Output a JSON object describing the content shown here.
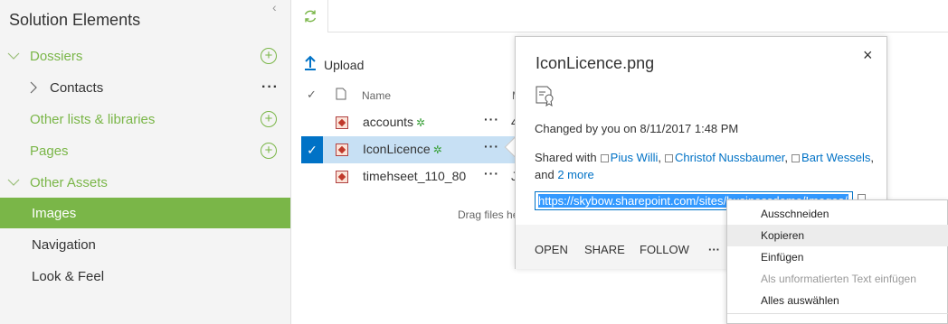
{
  "sidebar": {
    "title": "Solution Elements",
    "collapse_glyph": "‹",
    "items": [
      {
        "label": "Dossiers",
        "kind": "section",
        "expanded": true
      },
      {
        "label": "Contacts",
        "kind": "child"
      },
      {
        "label": "Other lists & libraries",
        "kind": "section"
      },
      {
        "label": "Pages",
        "kind": "section"
      },
      {
        "label": "Other Assets",
        "kind": "section",
        "expanded": true
      },
      {
        "label": "Images",
        "kind": "child",
        "active": true
      },
      {
        "label": "Navigation",
        "kind": "child"
      },
      {
        "label": "Look & Feel",
        "kind": "child"
      }
    ]
  },
  "library": {
    "upload_label": "Upload",
    "header_name": "Name",
    "header_modified_initial": "M",
    "rows": [
      {
        "name": "accounts",
        "trail": "4"
      },
      {
        "name": "IconLicence",
        "trail": ""
      },
      {
        "name": "timehseet_110_80",
        "trail": "J"
      }
    ],
    "drag_text": "Drag files he"
  },
  "callout": {
    "title": "IconLicence.png",
    "close": "×",
    "changed": "Changed by you on 8/11/2017 1:48 PM",
    "shared_prefix": "Shared with",
    "people": [
      "Pius Willi",
      "Christof Nussbaumer",
      "Bart Wessels"
    ],
    "and_text": "and",
    "more_link": "2 more",
    "url": "https://skybow.sharepoint.com/sites/businessdemo/Images/IconLicence.png",
    "actions": {
      "open": "OPEN",
      "share": "SHARE",
      "follow": "FOLLOW",
      "more": "···"
    }
  },
  "context_menu": {
    "items": [
      "Ausschneiden",
      "Kopieren",
      "Einfügen",
      "Als unformatierten Text einfügen",
      "Alles auswählen"
    ]
  },
  "colors": {
    "accent_green": "#7ab648",
    "accent_blue": "#0072c6",
    "selection_blue": "#c7e0f4"
  }
}
